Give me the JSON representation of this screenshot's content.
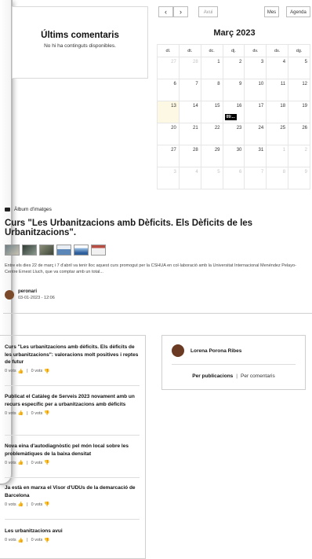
{
  "comments": {
    "title": "Últims comentaris",
    "empty": "No hi ha continguts disponibles."
  },
  "calendar": {
    "prev": "‹",
    "next": "›",
    "today": "Avui",
    "month_view": "Mes",
    "agenda_view": "Agenda",
    "title": "Març 2023",
    "weekdays": [
      "dl.",
      "dt.",
      "dc.",
      "dj.",
      "dv.",
      "ds.",
      "dg."
    ],
    "weeks": [
      [
        "27",
        "28",
        "1",
        "2",
        "3",
        "4",
        "5"
      ],
      [
        "6",
        "7",
        "8",
        "9",
        "10",
        "11",
        "12"
      ],
      [
        "13",
        "14",
        "15",
        "16",
        "17",
        "18",
        "19"
      ],
      [
        "20",
        "21",
        "22",
        "23",
        "24",
        "25",
        "26"
      ],
      [
        "27",
        "28",
        "29",
        "30",
        "31",
        "1",
        "2"
      ],
      [
        "3",
        "4",
        "5",
        "6",
        "7",
        "8",
        "9"
      ]
    ],
    "event_label": "09:..."
  },
  "album": {
    "kicker": "Àlbum d'imatges",
    "title": "Curs \"Les Urbanitzacions amb Dèficits. Els Dèficits de les Urbanitzacions\".",
    "description": "Entre els dies 22 de març i 7 d'abril va tenir lloc aquest curs promogut per la CSHUA en col·laboració amb la Universitat Internacional Menéndez Pelayo- Centre Ernest Lluch, que va comptar amb un total...",
    "author": "peronari",
    "date": "03-01-2023 - 12:06",
    "thumb_colors": [
      "#6d7f86",
      "#4f5c55",
      "#8a8f7a",
      "#5b86b8",
      "#9cc2e6",
      "#b84d43"
    ]
  },
  "posts": [
    {
      "title": "Curs \"Les urbanitzacions amb dèficits. Els dèficits de les urbanitzacions\": valoracions molt positives i reptes de futur",
      "up": "0 vots",
      "down": "0 vots"
    },
    {
      "title": "Publicat el Catàleg de Serveis 2023 novament amb un recurs específic per a urbanitzacions amb dèficits",
      "up": "0 vots",
      "down": "0 vots"
    },
    {
      "title": "Nova eina d'autodiagnòstic pel món local sobre les problemàtiques de la baixa densitat",
      "up": "0 vots",
      "down": "0 vots"
    },
    {
      "title": "Ja està en marxa el Visor d'UDUs de la demarcació de Barcelona",
      "up": "0 vots",
      "down": "0 vots"
    },
    {
      "title": "Les urbanitzacions avui",
      "up": "0 vots",
      "down": "0 vots"
    }
  ],
  "user": {
    "name": "Lorena Porona Ribes",
    "tab_publications": "Per publicacions",
    "separator": "|",
    "tab_comments": "Per comentaris"
  }
}
